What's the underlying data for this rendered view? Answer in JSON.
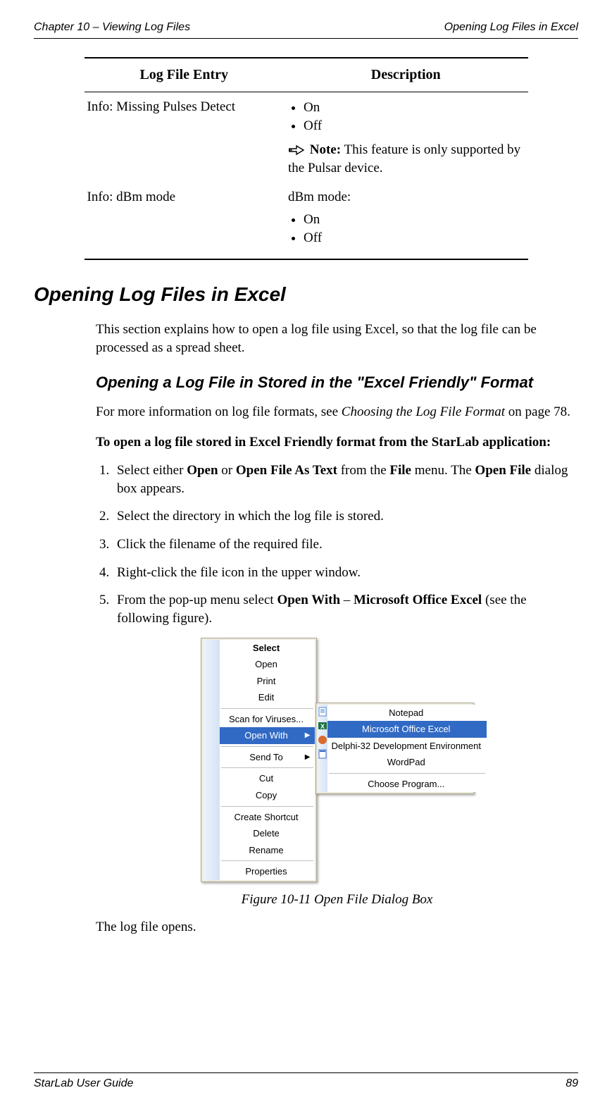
{
  "header": {
    "left": "Chapter 10 – Viewing Log Files",
    "right": "Opening Log Files in Excel"
  },
  "table": {
    "headers": [
      "Log File Entry",
      "Description"
    ],
    "rows": [
      {
        "entry": "Info: Missing Pulses Detect",
        "bullets": [
          "On",
          "Off"
        ],
        "note_label": "Note:",
        "note_text": " This feature is only supported by the Pulsar device."
      },
      {
        "entry": "Info: dBm mode",
        "lead": "dBm mode:",
        "bullets": [
          "On",
          "Off"
        ]
      }
    ]
  },
  "section": {
    "title": "Opening Log Files in Excel",
    "intro": "This section explains how to open a log file using Excel, so that the log file can be processed as a spread sheet.",
    "sub_title": "Opening a Log File in Stored in the \"Excel Friendly\" Format",
    "sub_intro_a": "For more information on log file formats, see ",
    "sub_intro_ital": "Choosing the Log File Format",
    "sub_intro_b": " on page 78.",
    "lead": "To open a log file stored in Excel Friendly format from the StarLab application:",
    "steps": {
      "s1_a": "Select either ",
      "s1_b1": "Open",
      "s1_c": " or ",
      "s1_b2": "Open File As Text",
      "s1_d": " from the ",
      "s1_b3": "File",
      "s1_e": " menu. The ",
      "s1_b4": "Open File",
      "s1_f": " dialog box appears.",
      "s2": "Select the directory in which the log file is stored.",
      "s3": "Click the filename of the required file.",
      "s4": "Right-click the file icon in the upper window.",
      "s5_a": "From the pop-up menu select ",
      "s5_b1": "Open With",
      "s5_c": " – ",
      "s5_b2": "Microsoft Office Excel",
      "s5_d": " (see the following figure)."
    },
    "context_menu": {
      "left": [
        "Select",
        "Open",
        "Print",
        "Edit",
        "Scan for Viruses...",
        "Open With",
        "Send To",
        "Cut",
        "Copy",
        "Create Shortcut",
        "Delete",
        "Rename",
        "Properties"
      ],
      "right": [
        "Notepad",
        "Microsoft Office Excel",
        "Delphi-32 Development Environment",
        "WordPad",
        "Choose Program..."
      ]
    },
    "figure_caption": "Figure 10-11 Open File Dialog Box",
    "after_figure": "The log file opens."
  },
  "footer": {
    "left": "StarLab User Guide",
    "right": "89"
  }
}
